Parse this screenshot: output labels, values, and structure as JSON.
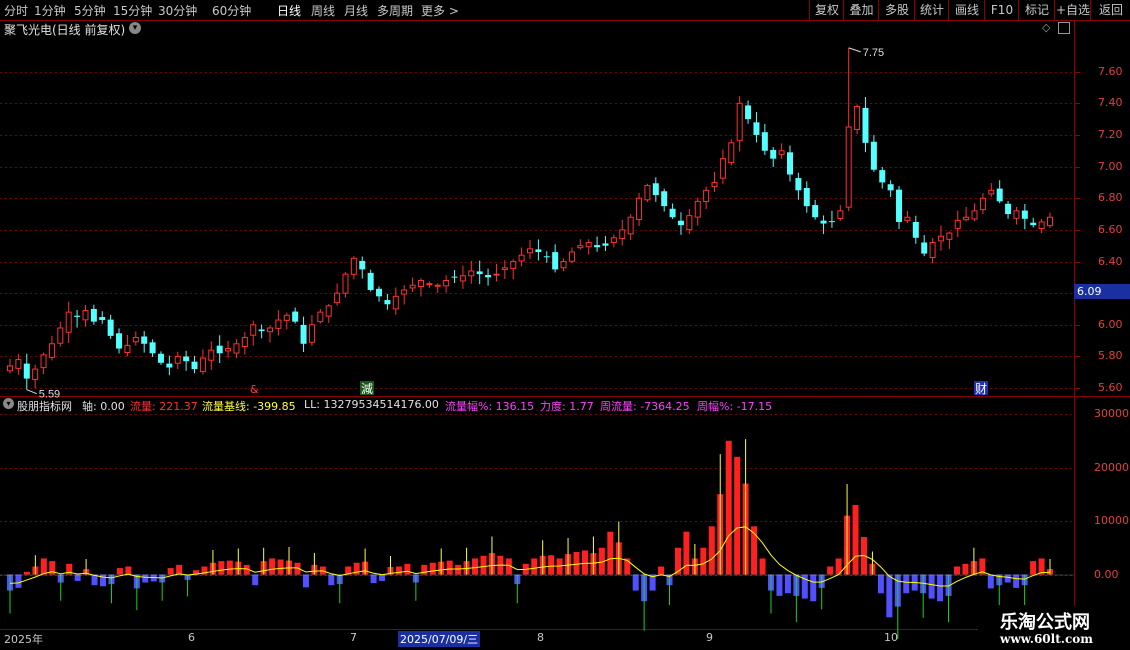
{
  "toolbar": {
    "periods": [
      "分时",
      "1分钟",
      "5分钟",
      "15分钟",
      "30分钟",
      "60分钟",
      "日线",
      "周线",
      "月线",
      "多周期",
      "更多 >"
    ],
    "active_period": "日线",
    "right_buttons": [
      "复权",
      "叠加",
      "多股",
      "统计",
      "画线",
      "F10",
      "标记",
      "+自选",
      "返回"
    ]
  },
  "chart_title": "聚飞光电(日线 前复权)",
  "price_axis": {
    "ticks": [
      "7.60",
      "7.40",
      "7.20",
      "7.00",
      "6.80",
      "6.60",
      "6.40",
      "6.20",
      "6.00",
      "5.80",
      "5.60"
    ],
    "current_price": "6.09"
  },
  "annotations": {
    "high": "7.75",
    "low": "5.59",
    "marker_1": "&",
    "marker_2": "減",
    "marker_3": "财"
  },
  "indicator": {
    "name": "股朋指标网",
    "axis_label": "轴: 0.00",
    "flow": "流量: 221.37",
    "flow_base": "流量基线: -399.85",
    "ll": "LL: 13279534514176.00",
    "flow_pct": "流量幅%: 136.15",
    "strength": "力度: 1.77",
    "week_flow": "周流量: -7364.25",
    "week_pct": "周幅%: -17.15",
    "ticks": [
      "30000",
      "20000",
      "10000",
      "0.00"
    ]
  },
  "date_axis": {
    "labels": [
      "2025年",
      "6",
      "7",
      "2025/07/09/三",
      "8",
      "9",
      "10"
    ]
  },
  "watermark": {
    "line1": "乐淘公式网",
    "line2": "www.60lt.com"
  },
  "colors": {
    "up": "#ff3030",
    "down": "#54ffff",
    "grid": "#8b0000",
    "volume_up": "#ff2020",
    "volume_down": "#5050ff",
    "ma_line": "#ffff00"
  },
  "chart_data": [
    {
      "type": "candlestick",
      "title": "聚飞光电(日线 前复权)",
      "ylim": [
        5.55,
        7.8
      ],
      "high": 7.75,
      "low": 5.59,
      "x_labels": [
        "2025年",
        "6",
        "7",
        "8",
        "9",
        "10"
      ],
      "closes": [
        5.74,
        5.78,
        5.66,
        5.72,
        5.81,
        5.88,
        5.98,
        6.08,
        6.05,
        6.09,
        6.02,
        6.03,
        5.93,
        5.85,
        5.87,
        5.92,
        5.88,
        5.82,
        5.76,
        5.73,
        5.8,
        5.77,
        5.72,
        5.79,
        5.84,
        5.82,
        5.85,
        5.88,
        5.92,
        6.0,
        5.96,
        5.98,
        6.03,
        6.06,
        6.02,
        5.88,
        6.0,
        6.08,
        6.12,
        6.2,
        6.32,
        6.42,
        6.35,
        6.22,
        6.18,
        6.13,
        6.18,
        6.22,
        6.25,
        6.28,
        6.26,
        6.25,
        6.28,
        6.3,
        6.31,
        6.34,
        6.32,
        6.3,
        6.32,
        6.36,
        6.4,
        6.44,
        6.48,
        6.46,
        6.43,
        6.35,
        6.4,
        6.46,
        6.5,
        6.52,
        6.49,
        6.5,
        6.55,
        6.6,
        6.68,
        6.8,
        6.88,
        6.82,
        6.75,
        6.68,
        6.63,
        6.69,
        6.78,
        6.85,
        6.9,
        7.05,
        7.15,
        7.4,
        7.3,
        7.2,
        7.1,
        7.05,
        7.1,
        6.95,
        6.85,
        6.75,
        6.68,
        6.64,
        6.65,
        6.72,
        7.25,
        7.38,
        7.15,
        6.98,
        6.9,
        6.85,
        6.65,
        6.68,
        6.55,
        6.45,
        6.52,
        6.56,
        6.58,
        6.66,
        6.68,
        6.72,
        6.8,
        6.85,
        6.78,
        6.7,
        6.72,
        6.67,
        6.63,
        6.65,
        6.68
      ]
    },
    {
      "type": "bar",
      "title": "股朋指标网",
      "ylim": [
        -10000,
        30000
      ],
      "series": [
        {
          "name": "流量",
          "values": [
            -3000,
            -2500,
            500,
            1500,
            3000,
            2500,
            -1500,
            2000,
            -1200,
            1000,
            -2000,
            -2200,
            -1800,
            1200,
            1500,
            -2600,
            -1500,
            -1300,
            -1500,
            1200,
            1800,
            -1000,
            800,
            1500,
            2200,
            2500,
            2600,
            2400,
            1800,
            -2000,
            2500,
            3000,
            2800,
            2600,
            2200,
            -2400,
            1800,
            1500,
            -2000,
            -1800,
            1500,
            2200,
            2400,
            -1600,
            -1200,
            1400,
            1500,
            2000,
            -1500,
            1800,
            2200,
            2400,
            2600,
            1800,
            2500,
            3000,
            3500,
            4000,
            3500,
            3000,
            -1800,
            2000,
            3000,
            3500,
            3600,
            3000,
            3800,
            4200,
            4500,
            4000,
            5000,
            8000,
            6000,
            3000,
            -3000,
            -5000,
            -3000,
            1500,
            -2000,
            5000,
            8000,
            3000,
            5000,
            9000,
            15000,
            25000,
            22000,
            17000,
            9000,
            3000,
            -3000,
            -4000,
            -3500,
            -4000,
            -4500,
            -5000,
            -2500,
            1500,
            3000,
            11000,
            13000,
            7000,
            2000,
            -3500,
            -8000,
            -6000,
            -3500,
            -3000,
            -3500,
            -4500,
            -5000,
            -4000,
            1500,
            2000,
            2500,
            3000,
            -2600,
            -2000,
            -1500,
            -2500,
            -2000,
            2500,
            3000,
            1000
          ]
        }
      ]
    }
  ]
}
